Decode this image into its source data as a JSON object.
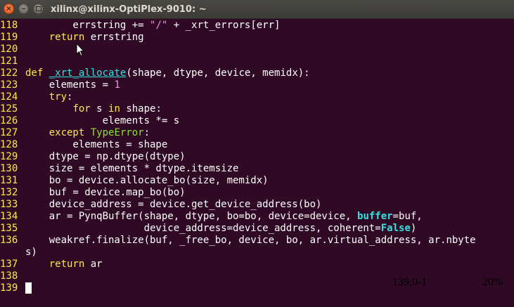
{
  "window": {
    "title": "xilinx@xilinx-OptiPlex-9010: ~",
    "close_glyph": "×",
    "minimize_glyph": "–"
  },
  "editor": {
    "lines": [
      {
        "n": "118",
        "tokens": [
          {
            "t": "        errstring += "
          },
          {
            "t": "\"/\"",
            "c": "str"
          },
          {
            "t": " + _xrt_errors[err]"
          }
        ]
      },
      {
        "n": "119",
        "tokens": [
          {
            "t": "    "
          },
          {
            "t": "return",
            "c": "kw"
          },
          {
            "t": " errstring"
          }
        ]
      },
      {
        "n": "120",
        "tokens": []
      },
      {
        "n": "121",
        "tokens": []
      },
      {
        "n": "122",
        "tokens": [
          {
            "t": "def",
            "c": "kw"
          },
          {
            "t": " "
          },
          {
            "t": "_xrt_allocate",
            "c": "fn under"
          },
          {
            "t": "(shape, dtype, device, memidx):"
          }
        ]
      },
      {
        "n": "123",
        "tokens": [
          {
            "t": "    elements = "
          },
          {
            "t": "1",
            "c": "num"
          }
        ]
      },
      {
        "n": "124",
        "tokens": [
          {
            "t": "    "
          },
          {
            "t": "try",
            "c": "kw"
          },
          {
            "t": ":"
          }
        ]
      },
      {
        "n": "125",
        "tokens": [
          {
            "t": "        "
          },
          {
            "t": "for",
            "c": "kw"
          },
          {
            "t": " s "
          },
          {
            "t": "in",
            "c": "kw"
          },
          {
            "t": " shape:"
          }
        ]
      },
      {
        "n": "126",
        "tokens": [
          {
            "t": "             elements *= s"
          }
        ]
      },
      {
        "n": "127",
        "tokens": [
          {
            "t": "    "
          },
          {
            "t": "except",
            "c": "kw"
          },
          {
            "t": " "
          },
          {
            "t": "TypeError",
            "c": "exc"
          },
          {
            "t": ":"
          }
        ]
      },
      {
        "n": "128",
        "tokens": [
          {
            "t": "        elements = shape"
          }
        ]
      },
      {
        "n": "129",
        "tokens": [
          {
            "t": "    dtype = np.dtype(dtype)"
          }
        ]
      },
      {
        "n": "130",
        "tokens": [
          {
            "t": "    size = elements * dtype.itemsize"
          }
        ]
      },
      {
        "n": "131",
        "tokens": [
          {
            "t": "    bo = device.allocate_bo(size, memidx)"
          }
        ]
      },
      {
        "n": "132",
        "tokens": [
          {
            "t": "    buf = device.map_bo(bo)"
          }
        ]
      },
      {
        "n": "133",
        "tokens": [
          {
            "t": "    device_address = device.get_device_address(bo)"
          }
        ]
      },
      {
        "n": "134",
        "tokens": [
          {
            "t": "    ar = PynqBuffer(shape, dtype, bo=bo, device=device, "
          },
          {
            "t": "buffer",
            "c": "kwarg"
          },
          {
            "t": "=buf,"
          }
        ]
      },
      {
        "n": "135",
        "tokens": [
          {
            "t": "                    device_address=device_address, coherent="
          },
          {
            "t": "False",
            "c": "const"
          },
          {
            "t": ")"
          }
        ]
      },
      {
        "n": "136",
        "tokens": [
          {
            "t": "    weakref.finalize(buf, _free_bo, device, bo, ar.virtual_address, ar.nbyte"
          }
        ]
      },
      {
        "n": "",
        "tokens": [
          {
            "t": "s)"
          }
        ],
        "wrap": true
      },
      {
        "n": "137",
        "tokens": [
          {
            "t": "    "
          },
          {
            "t": "return",
            "c": "kw"
          },
          {
            "t": " ar"
          }
        ]
      },
      {
        "n": "138",
        "tokens": []
      },
      {
        "n": "139",
        "tokens": [],
        "cursor": true
      }
    ]
  },
  "status": {
    "position": "139,0-1",
    "scroll": "20%"
  },
  "colors": {
    "background": "#300a24",
    "line_number": "#fce94f",
    "keyword": "#fce94f",
    "string": "#ef8fe0",
    "function_name": "#34e2e2",
    "exception": "#8ae234"
  }
}
